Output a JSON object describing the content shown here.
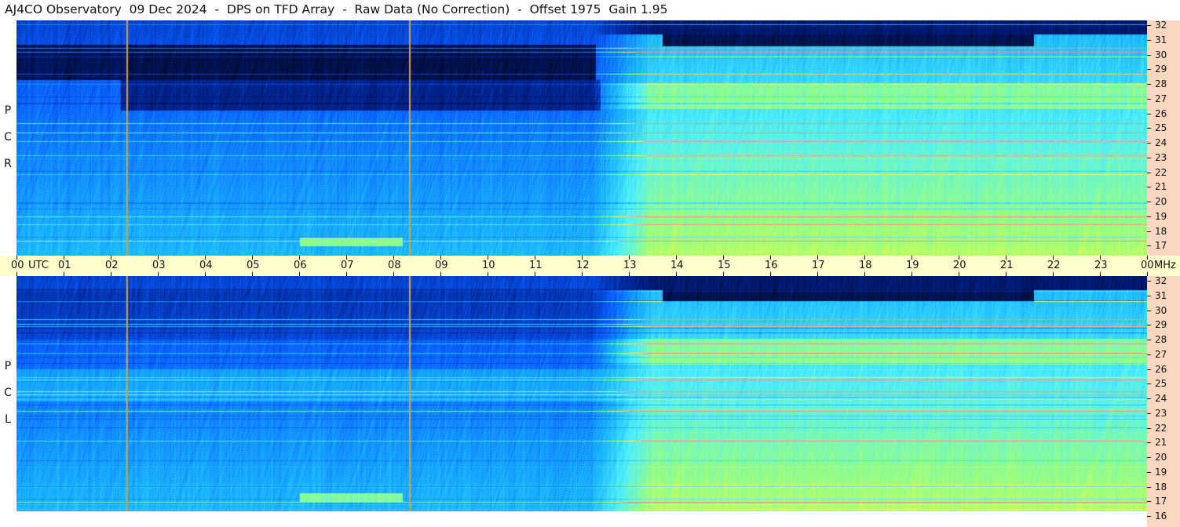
{
  "title": "AJ4CO Observatory  09 Dec 2024  -  DPS on TFD Array  -  Raw Data (No Correction)  -  Offset 1975  Gain 1.95",
  "chart_data": {
    "type": "heatmap",
    "x_axis": {
      "unit": "UTC",
      "ticks": [
        "00",
        "01",
        "02",
        "03",
        "04",
        "05",
        "06",
        "07",
        "08",
        "09",
        "10",
        "11",
        "12",
        "13",
        "14",
        "15",
        "16",
        "17",
        "18",
        "19",
        "20",
        "21",
        "22",
        "23",
        "00"
      ],
      "range_hours": [
        0,
        24
      ]
    },
    "y_axis": {
      "unit": "MHz",
      "ticks": [
        "32",
        "31",
        "30",
        "29",
        "28",
        "27",
        "26",
        "25",
        "24",
        "23",
        "22",
        "21",
        "20",
        "19",
        "18",
        "17",
        "16"
      ],
      "range_mhz": [
        16,
        32
      ]
    },
    "panels": [
      {
        "label_letters": [
          "P",
          "C",
          "R"
        ]
      },
      {
        "label_letters": [
          "P",
          "C",
          "L"
        ]
      }
    ],
    "colormap": [
      "#000820",
      "#00208a",
      "#0a5cff",
      "#19b4ff",
      "#4ef0ff",
      "#9cff7a",
      "#ffff3c",
      "#ff8a8a"
    ],
    "vertical_marker_hours": [
      2.33,
      8.33
    ],
    "marker_color": "#d8a030"
  }
}
